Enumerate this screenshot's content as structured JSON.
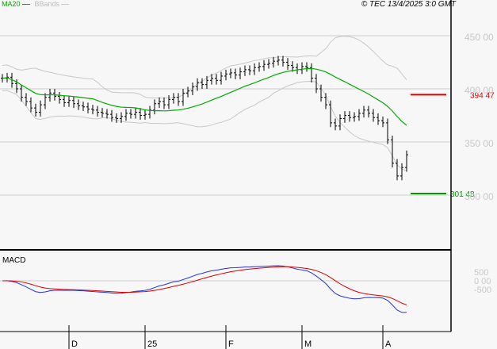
{
  "header": {
    "legend_ma": "MA20",
    "legend_bb": "BBands",
    "copyright": "© TEC 13/4/2025 3:0 GMT"
  },
  "colors": {
    "ma": "#00aa00",
    "bands": "#c8c8c8",
    "bars": "#000000",
    "resistance": "#dd0000",
    "support": "#009900",
    "macd": "#2233dd",
    "signal": "#dd0000",
    "grid": "#cccccc",
    "axis_text": "#c8c8c8"
  },
  "chart_data": [
    {
      "type": "line",
      "title": "Price (OHLC bars) with MA20 and Bollinger Bands",
      "y_ticks": [
        {
          "v": 450,
          "label": "450 00"
        },
        {
          "v": 400,
          "label": "400 00"
        },
        {
          "v": 350,
          "label": "350 00"
        },
        {
          "v": 300,
          "label": "300 00"
        }
      ],
      "ylim": [
        282,
        462
      ],
      "x_ticks": [
        {
          "i": 14,
          "label": "D"
        },
        {
          "i": 30,
          "label": "25"
        },
        {
          "i": 47,
          "label": "F"
        },
        {
          "i": 63,
          "label": "M"
        },
        {
          "i": 80,
          "label": "A"
        }
      ],
      "closes": [
        410,
        411,
        405,
        400,
        392,
        388,
        382,
        378,
        385,
        392,
        396,
        393,
        390,
        387,
        389,
        386,
        384,
        383,
        381,
        380,
        378,
        377,
        376,
        373,
        372,
        374,
        377,
        376,
        378,
        375,
        376,
        380,
        386,
        388,
        385,
        390,
        392,
        388,
        396,
        398,
        402,
        406,
        404,
        408,
        410,
        408,
        412,
        414,
        415,
        413,
        416,
        418,
        417,
        420,
        421,
        423,
        424,
        426,
        427,
        425,
        422,
        420,
        418,
        421,
        420,
        410,
        400,
        392,
        385,
        368,
        365,
        372,
        375,
        373,
        374,
        377,
        380,
        377,
        373,
        370,
        368,
        352,
        330,
        318,
        326,
        338
      ],
      "levels": [
        {
          "name": "resistance",
          "value": 394.47,
          "label": "394 47"
        },
        {
          "name": "support",
          "value": 301.48,
          "label": "301 48"
        }
      ]
    },
    {
      "type": "line",
      "title": "MACD",
      "y_ticks": [
        {
          "v": 5,
          "label": "500"
        },
        {
          "v": 0,
          "label": "0 00"
        },
        {
          "v": -5,
          "label": "-500"
        }
      ]
    }
  ]
}
